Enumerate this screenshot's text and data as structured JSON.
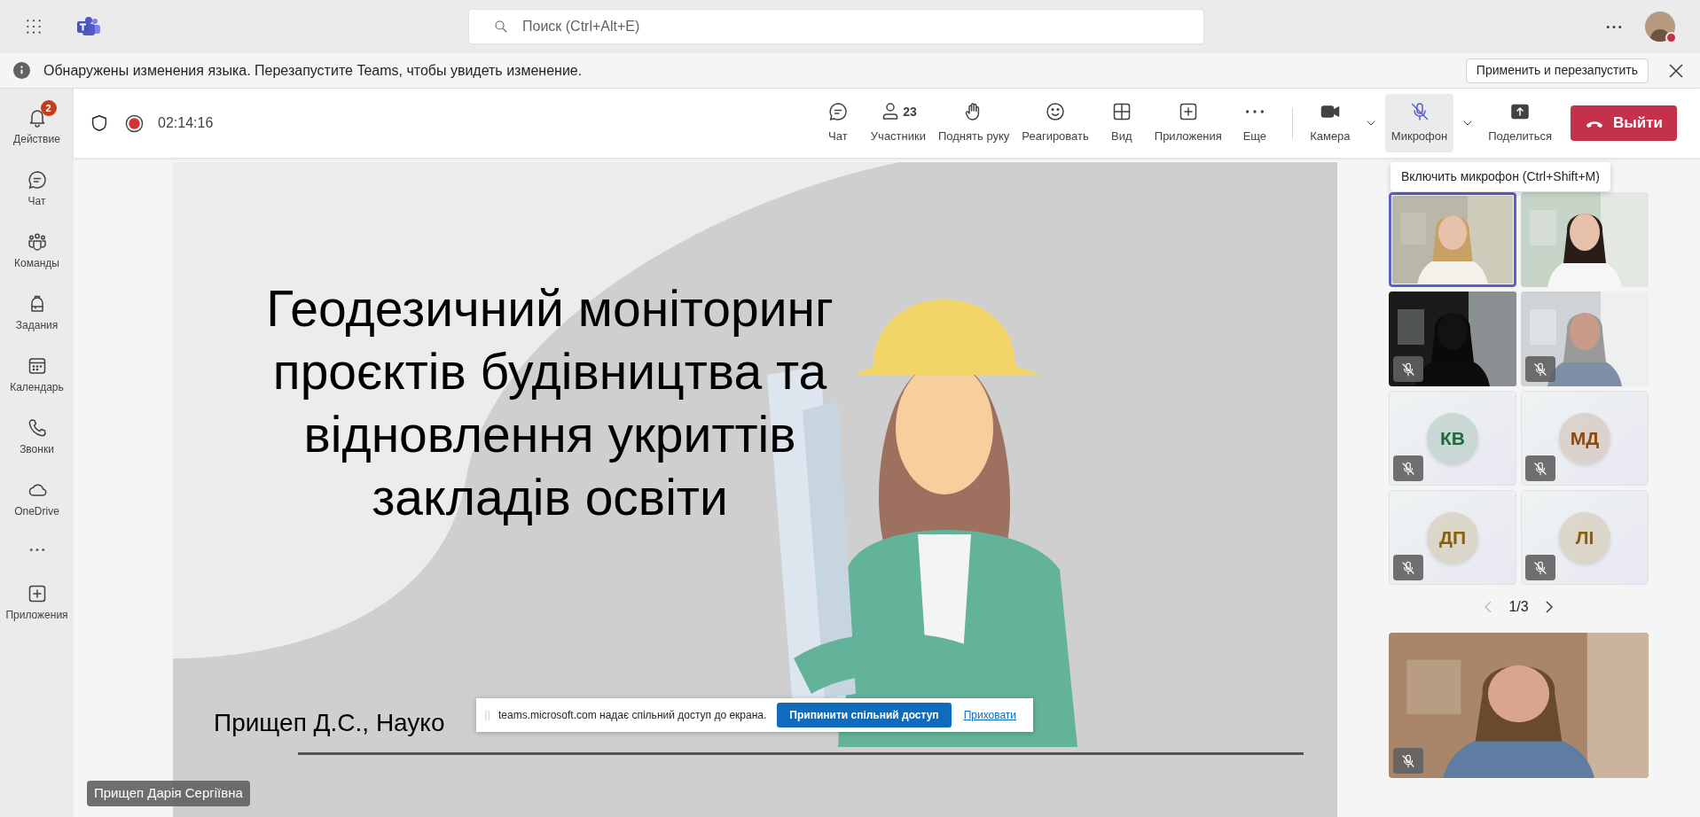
{
  "app_bar": {
    "search": {
      "placeholder": "Поиск (Ctrl+Alt+E)"
    }
  },
  "notice": {
    "text": "Обнаружены изменения языка. Перезапустите Teams, чтобы увидеть изменение.",
    "action": "Применить и перезапустить"
  },
  "rail": [
    {
      "label": "Действие",
      "badge": "2"
    },
    {
      "label": "Чат"
    },
    {
      "label": "Команды"
    },
    {
      "label": "Задания"
    },
    {
      "label": "Календарь"
    },
    {
      "label": "Звонки"
    },
    {
      "label": "OneDrive"
    }
  ],
  "rail_apps": {
    "label": "Приложения"
  },
  "meeting": {
    "recording": true,
    "timer": "02:14:16",
    "toolbar": [
      {
        "label": "Чат"
      },
      {
        "label": "Участники",
        "count": "23"
      },
      {
        "label": "Поднять руку"
      },
      {
        "label": "Реагировать"
      },
      {
        "label": "Вид"
      },
      {
        "label": "Приложения"
      },
      {
        "label": "Еще"
      },
      {
        "label": "Камера",
        "dropdown": true,
        "separator_before": true
      },
      {
        "label": "Микрофон",
        "dropdown": true,
        "highlighted": true
      },
      {
        "label": "Поделиться"
      }
    ],
    "leave": "Выйти",
    "tooltip": "Включить микрофон (Ctrl+Shift+M)"
  },
  "stage": {
    "slide": {
      "title": [
        "Геодезичний моніторинг",
        "проєктів будівництва та",
        "відновлення укриттів",
        "закладів освіти"
      ],
      "subtitle": "Прищеп Д.С., Науко"
    },
    "share_bar": {
      "text": "teams.microsoft.com надає спільний доступ до екрана.",
      "stop": "Припинити спільний доступ",
      "hide": "Приховати"
    },
    "presenter": "Прищеп Дарія Сергіївна"
  },
  "gallery": {
    "tiles": [
      {
        "kind": "video",
        "selected": true,
        "muted": false
      },
      {
        "kind": "video",
        "selected": false,
        "muted": false
      },
      {
        "kind": "video",
        "selected": false,
        "muted": true
      },
      {
        "kind": "video",
        "selected": false,
        "muted": true
      },
      {
        "kind": "avatar",
        "initials": "КВ",
        "color": "#1f6b3c",
        "selected": false,
        "muted": true
      },
      {
        "kind": "avatar",
        "initials": "МД",
        "color": "#8a4a14",
        "selected": false,
        "muted": true
      },
      {
        "kind": "avatar",
        "initials": "ДП",
        "color": "#8a6000",
        "selected": false,
        "muted": true
      },
      {
        "kind": "avatar",
        "initials": "ЛІ",
        "color": "#8a6000",
        "selected": false,
        "muted": true
      }
    ],
    "pager": "1/3",
    "self_view": {
      "muted": true
    }
  }
}
